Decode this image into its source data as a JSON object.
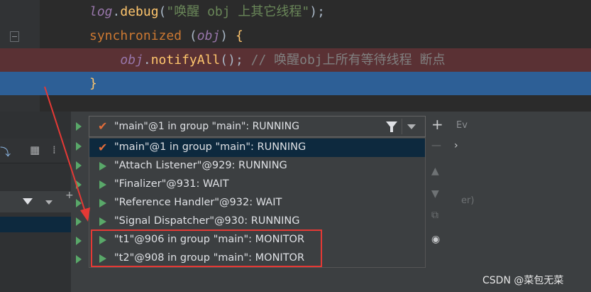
{
  "editor": {
    "lines": [
      {
        "kind": "normal",
        "tokens": [
          {
            "cls": "tok-ident",
            "text": "log"
          },
          {
            "cls": "tok-plain",
            "text": "."
          },
          {
            "cls": "tok-method",
            "text": "debug"
          },
          {
            "cls": "tok-plain",
            "text": "("
          },
          {
            "cls": "tok-str",
            "text": "\"唤醒 obj 上其它线程\""
          },
          {
            "cls": "tok-plain",
            "text": ");"
          }
        ]
      },
      {
        "kind": "normal",
        "tokens": [
          {
            "cls": "tok-kw",
            "text": "synchronized"
          },
          {
            "cls": "tok-plain",
            "text": " ("
          },
          {
            "cls": "tok-ident",
            "text": "obj"
          },
          {
            "cls": "tok-plain",
            "text": ") "
          },
          {
            "cls": "tok-brace",
            "text": "{"
          }
        ]
      },
      {
        "kind": "breakpoint",
        "tokens": [
          {
            "cls": "tok-plain",
            "text": "    "
          },
          {
            "cls": "tok-ident",
            "text": "obj"
          },
          {
            "cls": "tok-plain",
            "text": "."
          },
          {
            "cls": "tok-method",
            "text": "notifyAll"
          },
          {
            "cls": "tok-plain",
            "text": "(); "
          },
          {
            "cls": "tok-comment",
            "text": "// 唤醒obj上所有等待线程 断点"
          }
        ]
      },
      {
        "kind": "execution",
        "tokens": [
          {
            "cls": "tok-brace",
            "text": "}"
          }
        ]
      }
    ]
  },
  "thread_selector": {
    "selected": "\"main\"@1 in group \"main\": RUNNING",
    "filter_icon": "filter-icon",
    "dropdown_icon": "chevron-down-icon"
  },
  "thread_list": [
    {
      "label": "\"main\"@1 in group \"main\": RUNNING",
      "icon": "check-icon",
      "selected": true
    },
    {
      "label": "\"Attach Listener\"@929: RUNNING",
      "icon": "play-icon",
      "selected": false
    },
    {
      "label": "\"Finalizer\"@931: WAIT",
      "icon": "play-icon",
      "selected": false
    },
    {
      "label": "\"Reference Handler\"@932: WAIT",
      "icon": "play-icon",
      "selected": false
    },
    {
      "label": "\"Signal Dispatcher\"@930: RUNNING",
      "icon": "play-icon",
      "selected": false
    },
    {
      "label": "\"t1\"@906 in group \"main\": MONITOR",
      "icon": "play-icon",
      "selected": false
    },
    {
      "label": "\"t2\"@908 in group \"main\": MONITOR",
      "icon": "play-icon",
      "selected": false
    }
  ],
  "right_panel": {
    "tab_partial": "Ev",
    "text_partial": "er)"
  },
  "colors": {
    "breakpoint_line": "#5a3134",
    "execution_line": "#2d5f96",
    "selection": "#0d293e",
    "highlight_box": "#e53935",
    "annotation_arrow": "#e53935"
  },
  "watermark": "CSDN @菜包无菜"
}
